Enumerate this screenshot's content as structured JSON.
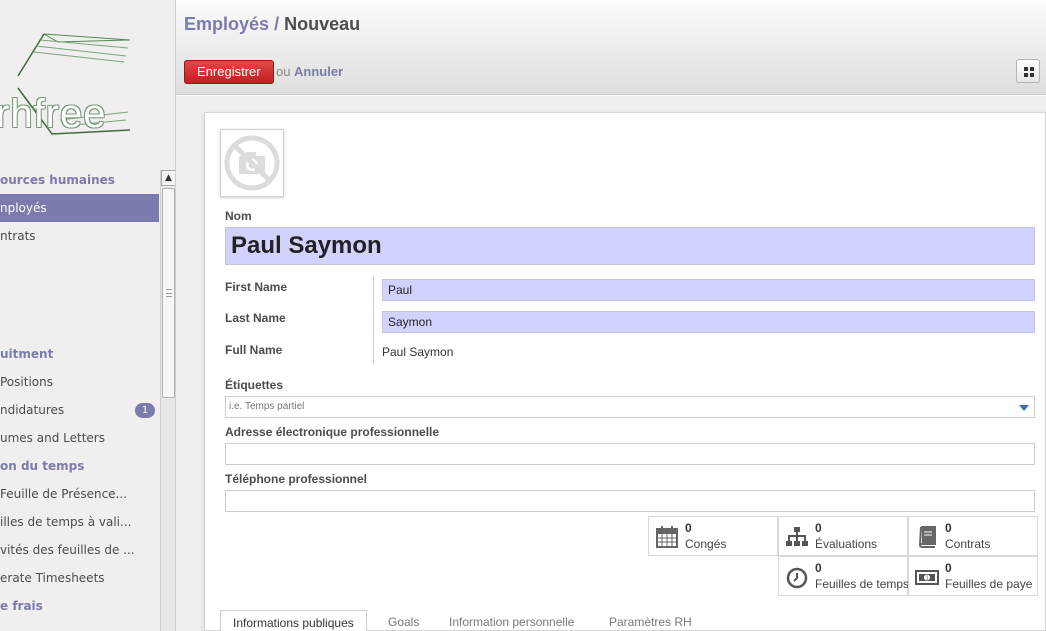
{
  "app": {
    "logo_text": "rhfree"
  },
  "sidebar": {
    "menu": [
      {
        "type": "section",
        "label": "ources humaines"
      },
      {
        "type": "item",
        "label": "nployés",
        "active": true
      },
      {
        "type": "item",
        "label": "ntrats"
      },
      {
        "type": "spacer"
      },
      {
        "type": "section",
        "label": "uitment"
      },
      {
        "type": "item",
        "label": "Positions"
      },
      {
        "type": "item",
        "label": "ndidatures",
        "badge": "1"
      },
      {
        "type": "item",
        "label": "umes and Letters"
      },
      {
        "type": "section",
        "label": "on du temps"
      },
      {
        "type": "item",
        "label": "Feuille de Présence..."
      },
      {
        "type": "item",
        "label": "illes de temps à vali..."
      },
      {
        "type": "item",
        "label": "vités des feuilles de ..."
      },
      {
        "type": "item",
        "label": "erate Timesheets"
      },
      {
        "type": "section",
        "label": "e frais"
      }
    ]
  },
  "header": {
    "breadcrumb_parent": "Employés",
    "breadcrumb_separator": "/",
    "breadcrumb_current": "Nouveau",
    "save_label": "Enregistrer",
    "or_label": "ou",
    "cancel_label": "Annuler"
  },
  "form": {
    "name_label": "Nom",
    "name_value": "Paul Saymon",
    "first_name_label": "First Name",
    "first_name_value": "Paul",
    "last_name_label": "Last Name",
    "last_name_value": "Saymon",
    "full_name_label": "Full Name",
    "full_name_value": "Paul Saymon",
    "tags_label": "Étiquettes",
    "tags_placeholder": "i.e. Temps partiel",
    "work_email_label": "Adresse électronique professionnelle",
    "work_email_value": "",
    "work_phone_label": "Téléphone professionnel",
    "work_phone_value": ""
  },
  "smart_buttons": {
    "conges": {
      "count": "0",
      "label": "Congés",
      "icon": "calendar-icon"
    },
    "evaluations": {
      "count": "0",
      "label": "Évaluations",
      "icon": "sitemap-icon"
    },
    "contrats": {
      "count": "0",
      "label": "Contrats",
      "icon": "book-icon"
    },
    "feuilles_temps": {
      "count": "0",
      "label": "Feuilles de temps",
      "icon": "clock-icon"
    },
    "feuilles_paye": {
      "count": "0",
      "label": "Feuilles de paye",
      "icon": "money-icon"
    }
  },
  "tabs": [
    {
      "label": "Informations publiques",
      "active": true
    },
    {
      "label": "Goals"
    },
    {
      "label": "Information personnelle"
    },
    {
      "label": "Paramètres RH"
    }
  ],
  "colors": {
    "accent": "#7c7bad",
    "required_field": "#d2d2ff",
    "save_button": "#d03232"
  }
}
